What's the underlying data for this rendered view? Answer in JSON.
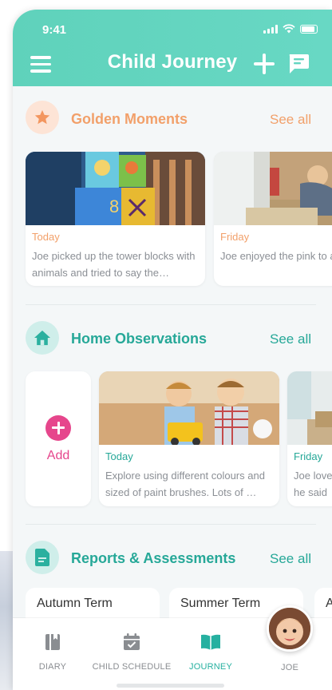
{
  "status_bar": {
    "time": "9:41"
  },
  "header": {
    "title": "Child Journey"
  },
  "colors": {
    "header": "#63d5c0",
    "golden": "#f2a06a",
    "teal": "#26a898",
    "add": "#e6468c",
    "active_tab": "#26b0a0"
  },
  "golden_moments": {
    "title": "Golden Moments",
    "see_all": "See all",
    "cards": [
      {
        "day": "Today",
        "text": "Joe picked up the tower blocks with animals and tried to say the…"
      },
      {
        "day": "Friday",
        "text": "Joe enjoyed the pink to and placed the largest c"
      }
    ]
  },
  "home_observations": {
    "title": "Home Observations",
    "see_all": "See all",
    "add_label": "Add",
    "cards": [
      {
        "day": "Today",
        "text": "Explore using different colours and sized of paint brushes. Lots of …"
      },
      {
        "day": "Friday",
        "text": "Joe love he said"
      }
    ]
  },
  "reports": {
    "title": "Reports & Assessments",
    "see_all": "See all",
    "terms": [
      "Autumn Term",
      "Summer Term",
      "A"
    ]
  },
  "tabs": [
    {
      "label": "DIARY",
      "icon": "diary-icon",
      "active": false
    },
    {
      "label": "CHILD SCHEDULE",
      "icon": "schedule-icon",
      "active": false
    },
    {
      "label": "JOURNEY",
      "icon": "book-icon",
      "active": true
    },
    {
      "label": "JOE",
      "icon": "avatar",
      "active": false
    }
  ]
}
